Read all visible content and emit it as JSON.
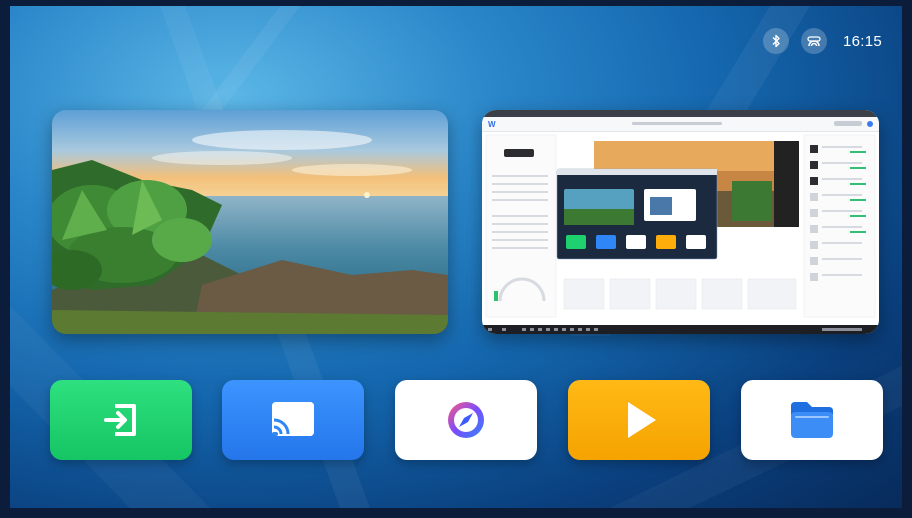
{
  "status_bar": {
    "clock": "16:15",
    "bluetooth_icon": "bluetooth-icon",
    "cast_icon": "screen-mirroring-icon"
  },
  "cards": [
    {
      "name": "wallpaper-preview",
      "content": "coastline-photo"
    },
    {
      "name": "cast-preview",
      "content": "mirrored-desktop"
    }
  ],
  "dock": [
    {
      "name": "input-source",
      "icon": "input-source-icon",
      "color": "#1fd06e"
    },
    {
      "name": "screen-cast",
      "icon": "screen-cast-icon",
      "color": "#2f86f6"
    },
    {
      "name": "browser",
      "icon": "compass-icon",
      "color": "#ffffff"
    },
    {
      "name": "video-player",
      "icon": "play-icon",
      "color": "#ffad0a"
    },
    {
      "name": "file-manager",
      "icon": "folder-icon",
      "color": "#ffffff"
    }
  ]
}
